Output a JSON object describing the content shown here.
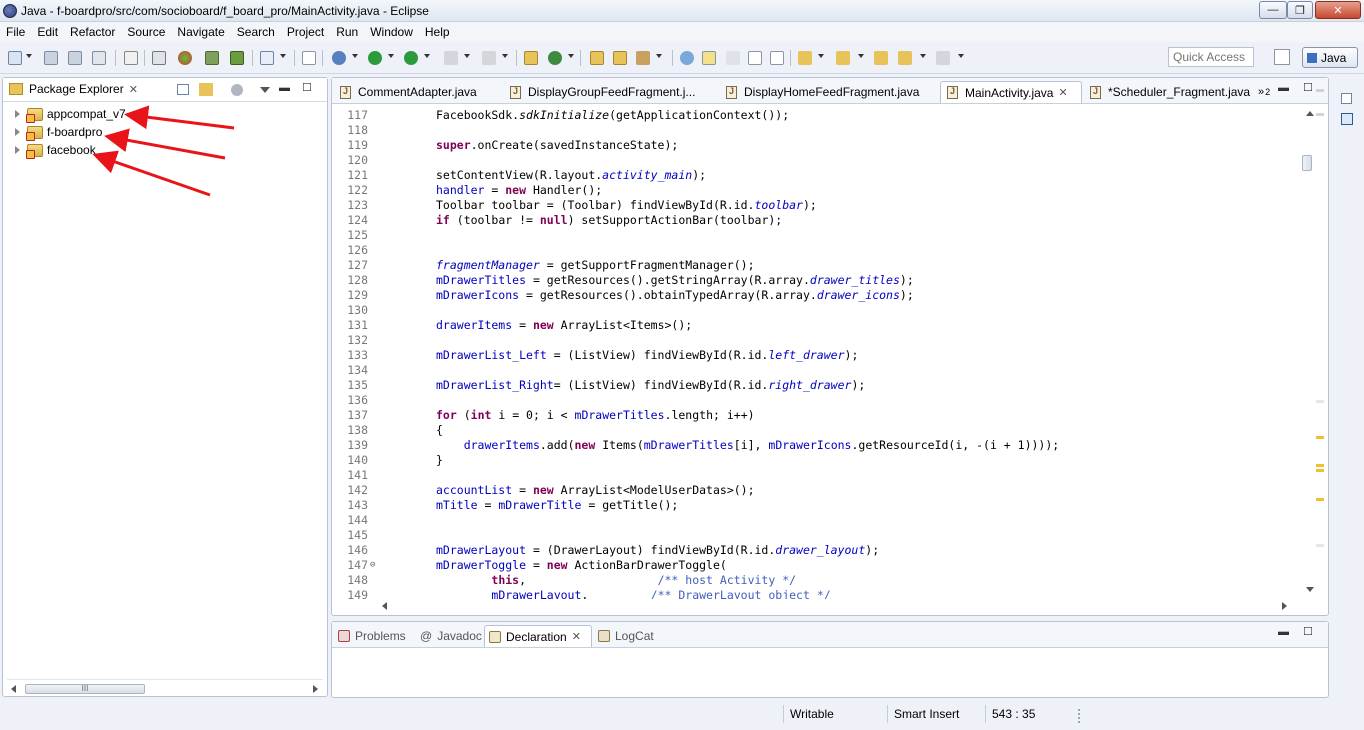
{
  "window": {
    "title": "Java - f-boardpro/src/com/socioboard/f_board_pro/MainActivity.java - Eclipse",
    "minimize_glyph": "—",
    "maximize_glyph": "❐",
    "close_glyph": "✕"
  },
  "menu": [
    "File",
    "Edit",
    "Refactor",
    "Source",
    "Navigate",
    "Search",
    "Project",
    "Run",
    "Window",
    "Help"
  ],
  "toolbar": {
    "quick_access_placeholder": "Quick Access",
    "perspective_label": "Java"
  },
  "package_explorer": {
    "title": "Package Explorer",
    "close_glyph": "✕",
    "projects": [
      {
        "name": "appcompat_v7"
      },
      {
        "name": "f-boardpro"
      },
      {
        "name": "facebook"
      }
    ],
    "hscroll_grip": "III"
  },
  "editor": {
    "tabs": [
      {
        "label": "CommentAdapter.java",
        "active": false
      },
      {
        "label": "DisplayGroupFeedFragment.j...",
        "active": false
      },
      {
        "label": "DisplayHomeFeedFragment.java",
        "active": false
      },
      {
        "label": "MainActivity.java",
        "active": true
      },
      {
        "label": "*Scheduler_Fragment.java",
        "active": false
      }
    ],
    "overflow_label": "»",
    "overflow_count": "2",
    "lines": [
      {
        "n": "117",
        "segs": [
          [
            "t",
            "FacebookSdk."
          ],
          [
            "sm",
            "sdkInitialize"
          ],
          [
            "t",
            "(getApplicationContext());"
          ]
        ]
      },
      {
        "n": "118",
        "segs": []
      },
      {
        "n": "119",
        "segs": [
          [
            "kw",
            "super"
          ],
          [
            "t",
            ".onCreate(savedInstanceState);"
          ]
        ]
      },
      {
        "n": "120",
        "segs": []
      },
      {
        "n": "121",
        "segs": [
          [
            "t",
            "setContentView(R.layout."
          ],
          [
            "sf",
            "activity_main"
          ],
          [
            "t",
            ");"
          ]
        ]
      },
      {
        "n": "122",
        "segs": [
          [
            "f",
            "handler"
          ],
          [
            "t",
            " = "
          ],
          [
            "kw",
            "new"
          ],
          [
            "t",
            " Handler();"
          ]
        ]
      },
      {
        "n": "123",
        "segs": [
          [
            "t",
            "Toolbar toolbar = (Toolbar) findViewById(R.id."
          ],
          [
            "sf",
            "toolbar"
          ],
          [
            "t",
            ");"
          ]
        ]
      },
      {
        "n": "124",
        "segs": [
          [
            "kw",
            "if"
          ],
          [
            "t",
            " (toolbar != "
          ],
          [
            "kw",
            "null"
          ],
          [
            "t",
            ") setSupportActionBar(toolbar);"
          ]
        ]
      },
      {
        "n": "125",
        "segs": []
      },
      {
        "n": "126",
        "segs": []
      },
      {
        "n": "127",
        "segs": [
          [
            "sf",
            "fragmentManager"
          ],
          [
            "t",
            " = getSupportFragmentManager();"
          ]
        ]
      },
      {
        "n": "128",
        "segs": [
          [
            "f",
            "mDrawerTitles"
          ],
          [
            "t",
            " = getResources().getStringArray(R.array."
          ],
          [
            "sf",
            "drawer_titles"
          ],
          [
            "t",
            ");"
          ]
        ]
      },
      {
        "n": "129",
        "segs": [
          [
            "f",
            "mDrawerIcons"
          ],
          [
            "t",
            " = getResources().obtainTypedArray(R.array."
          ],
          [
            "sf",
            "drawer_icons"
          ],
          [
            "t",
            ");"
          ]
        ]
      },
      {
        "n": "130",
        "segs": []
      },
      {
        "n": "131",
        "segs": [
          [
            "f",
            "drawerItems"
          ],
          [
            "t",
            " = "
          ],
          [
            "kw",
            "new"
          ],
          [
            "t",
            " ArrayList<Items>();"
          ]
        ]
      },
      {
        "n": "132",
        "segs": []
      },
      {
        "n": "133",
        "segs": [
          [
            "f",
            "mDrawerList_Left"
          ],
          [
            "t",
            " = (ListView) findViewById(R.id."
          ],
          [
            "sf",
            "left_drawer"
          ],
          [
            "t",
            ");"
          ]
        ]
      },
      {
        "n": "134",
        "segs": []
      },
      {
        "n": "135",
        "segs": [
          [
            "f",
            "mDrawerList_Right"
          ],
          [
            "t",
            "= (ListView) findViewById(R.id."
          ],
          [
            "sf",
            "right_drawer"
          ],
          [
            "t",
            ");"
          ]
        ]
      },
      {
        "n": "136",
        "segs": []
      },
      {
        "n": "137",
        "segs": [
          [
            "kw",
            "for"
          ],
          [
            "t",
            " ("
          ],
          [
            "kw",
            "int"
          ],
          [
            "t",
            " i = 0; i < "
          ],
          [
            "f",
            "mDrawerTitles"
          ],
          [
            "t",
            ".length; i++)"
          ]
        ]
      },
      {
        "n": "138",
        "segs": [
          [
            "t",
            "{"
          ]
        ]
      },
      {
        "n": "139",
        "segs": [
          [
            "t",
            "    "
          ],
          [
            "f",
            "drawerItems"
          ],
          [
            "t",
            ".add("
          ],
          [
            "kw",
            "new"
          ],
          [
            "t",
            " Items("
          ],
          [
            "f",
            "mDrawerTitles"
          ],
          [
            "t",
            "[i], "
          ],
          [
            "f",
            "mDrawerIcons"
          ],
          [
            "t",
            ".getResourceId(i, -(i + 1))));"
          ]
        ]
      },
      {
        "n": "140",
        "segs": [
          [
            "t",
            "}"
          ]
        ]
      },
      {
        "n": "141",
        "segs": []
      },
      {
        "n": "142",
        "segs": [
          [
            "f",
            "accountList"
          ],
          [
            "t",
            " = "
          ],
          [
            "kw",
            "new"
          ],
          [
            "t",
            " ArrayList<ModelUserDatas>();"
          ]
        ]
      },
      {
        "n": "143",
        "segs": [
          [
            "f",
            "mTitle"
          ],
          [
            "t",
            " = "
          ],
          [
            "f",
            "mDrawerTitle"
          ],
          [
            "t",
            " = getTitle();"
          ]
        ]
      },
      {
        "n": "144",
        "segs": []
      },
      {
        "n": "145",
        "segs": []
      },
      {
        "n": "146",
        "segs": [
          [
            "f",
            "mDrawerLayout"
          ],
          [
            "t",
            " = (DrawerLayout) findViewById(R.id."
          ],
          [
            "sf",
            "drawer_layout"
          ],
          [
            "t",
            ");"
          ]
        ]
      },
      {
        "n": "147",
        "fold": "⊖",
        "segs": [
          [
            "f",
            "mDrawerToggle"
          ],
          [
            "t",
            " = "
          ],
          [
            "kw",
            "new"
          ],
          [
            "t",
            " ActionBarDrawerToggle("
          ]
        ]
      },
      {
        "n": "148",
        "segs": [
          [
            "t",
            "        "
          ],
          [
            "kw",
            "this"
          ],
          [
            "t",
            ",                   "
          ],
          [
            "c",
            "/** host Activity */"
          ]
        ]
      },
      {
        "n": "149",
        "segs": [
          [
            "t",
            "        "
          ],
          [
            "f",
            "mDrawerLayout"
          ],
          [
            "t",
            ",         "
          ],
          [
            "c",
            "/** DrawerLayout object */"
          ]
        ]
      }
    ]
  },
  "bottom_panel": {
    "tabs": [
      {
        "label": "Problems",
        "active": false
      },
      {
        "label": "Javadoc",
        "active": false
      },
      {
        "label": "Declaration",
        "active": true
      },
      {
        "label": "LogCat",
        "active": false
      }
    ],
    "close_glyph": "✕"
  },
  "status": {
    "mode": "Writable",
    "insert": "Smart Insert",
    "position": "543 : 35"
  },
  "panel_controls": {
    "minimize": "▬",
    "maximize": "☐"
  },
  "colors": {
    "annotation_arrow": "#e8141a",
    "keyword": "#7f0055",
    "field": "#0000c0",
    "comment": "#3f5fbf"
  }
}
